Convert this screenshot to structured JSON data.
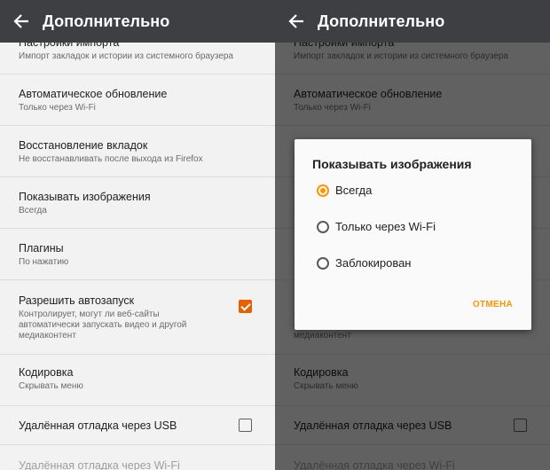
{
  "header": {
    "title": "Дополнительно"
  },
  "settings": {
    "items": [
      {
        "title": "Настройки импорта",
        "subtitle": "Импорт закладок и истории из системного браузера"
      },
      {
        "title": "Автоматическое обновление",
        "subtitle": "Только через Wi-Fi"
      },
      {
        "title": "Восстановление вкладок",
        "subtitle": "Не восстанавливать после выхода из Firefox"
      },
      {
        "title": "Показывать изображения",
        "subtitle": "Всегда"
      },
      {
        "title": "Плагины",
        "subtitle": "По нажатию"
      },
      {
        "title": "Разрешить автозапуск",
        "subtitle_lines": [
          "Контролирует, могут ли веб-сайты",
          "автоматически запускать видео и другой",
          "медиаконтент"
        ],
        "checked": true
      },
      {
        "title": "Кодировка",
        "subtitle": "Скрывать меню"
      },
      {
        "title": "Удалённая отладка через USB",
        "checked": false
      },
      {
        "title": "Удалённая отладка через Wi-Fi"
      }
    ]
  },
  "dialog": {
    "title": "Показывать изображения",
    "options": [
      {
        "label": "Всегда",
        "selected": true
      },
      {
        "label": "Только через Wi-Fi",
        "selected": false
      },
      {
        "label": "Заблокирован",
        "selected": false
      }
    ],
    "cancel_label": "ОТМЕНА"
  },
  "colors": {
    "toolbar": "#3d3f42",
    "accent_checkbox": "#e66000",
    "accent_radio": "#ff9400"
  }
}
